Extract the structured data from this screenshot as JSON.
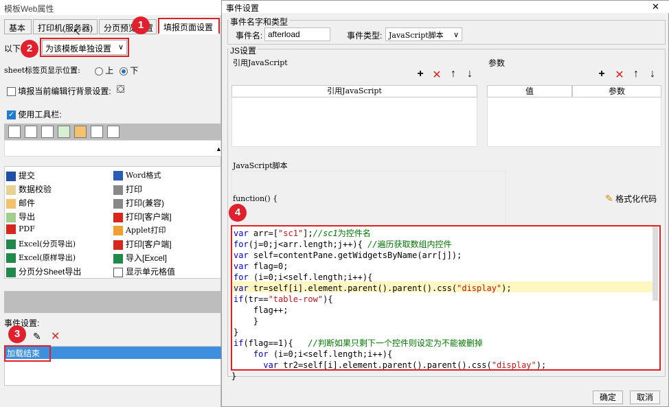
{
  "left_window": {
    "title": "模板Web属性",
    "tabs": [
      {
        "label": "基本"
      },
      {
        "label": "打印机(服务器)"
      },
      {
        "label": "分页预览设置"
      },
      {
        "label": "填报页面设置"
      }
    ],
    "scope_label": "以下",
    "scope_select": "为该模板单独设置",
    "sheet_label": "sheet标签页显示位置:",
    "sheet_options": [
      "上",
      "下"
    ],
    "sheet_selected": "下",
    "bg_label": "填报当前编辑行背景设置:",
    "use_toolbar_label": "使用工具栏:",
    "grid_col1": [
      "提交",
      "数据校验",
      "邮件",
      "导出",
      "PDF",
      "Excel(分页导出)",
      "Excel(原样导出)",
      "分页分Sheet导出"
    ],
    "grid_col2": [
      "Word格式",
      "打印",
      "打印(兼容)",
      "打印[客户端]",
      "Applet打印",
      "打印[客户端]",
      "导入[Excel]",
      "显示单元格值"
    ],
    "event_label": "事件设置:",
    "event_items": [
      "加载结束"
    ]
  },
  "dialog": {
    "title": "事件设置",
    "close": "✕",
    "event_group": "事件名字和类型",
    "event_name_label": "事件名:",
    "event_name_value": "afterload",
    "event_type_label": "事件类型:",
    "event_type_value": "JavaScript脚本",
    "js_group": "JS设置",
    "ref_js_label": "引用JavaScript",
    "ref_js_header": "引用JavaScript",
    "params_label": "参数",
    "params_headers": [
      "值",
      "参数"
    ],
    "js_script_label": "JavaScript脚本",
    "function_text": "function() {",
    "format_code": "格式化代码",
    "closing_brace": "}",
    "ok": "确定",
    "cancel": "取消"
  },
  "badges": [
    "1",
    "2",
    "3",
    "4"
  ],
  "code_lines": [
    [
      {
        "t": "var",
        "c": "kw"
      },
      {
        "t": " arr=["
      },
      {
        "t": "\"sc1\"",
        "c": "str"
      },
      {
        "t": "];"
      },
      {
        "t": "//sc1",
        "c": "cm"
      },
      {
        "t": "为控件名",
        "c": "cmz"
      }
    ],
    [
      {
        "t": "for",
        "c": "kw"
      },
      {
        "t": "(j=0;j<arr.length;j++){ "
      },
      {
        "t": "//",
        "c": "cm"
      },
      {
        "t": "遍历获取数组内控件",
        "c": "cmz"
      }
    ],
    [
      {
        "t": "var",
        "c": "kw"
      },
      {
        "t": " self=contentPane.getWidgetsByName(arr[j]);"
      }
    ],
    [
      {
        "t": "var",
        "c": "kw"
      },
      {
        "t": " flag=0;"
      }
    ],
    [
      {
        "t": "for",
        "c": "kw"
      },
      {
        "t": " (i=0;i<self.length;i++){"
      }
    ],
    [
      {
        "t": "var",
        "c": "kw"
      },
      {
        "t": " tr=self[i].element.parent().parent().css("
      },
      {
        "t": "\"display\"",
        "c": "str"
      },
      {
        "t": ");"
      }
    ],
    [
      {
        "t": "if",
        "c": "kw"
      },
      {
        "t": "(tr=="
      },
      {
        "t": "\"table-row\"",
        "c": "str"
      },
      {
        "t": "){"
      }
    ],
    [
      {
        "t": "    flag++;"
      }
    ],
    [
      {
        "t": "    }"
      }
    ],
    [
      {
        "t": "}"
      }
    ],
    [
      {
        "t": "if",
        "c": "kw"
      },
      {
        "t": "(flag==1){   "
      },
      {
        "t": "//",
        "c": "cm"
      },
      {
        "t": "判断如果只剩下一个控件则设定为不能被删掉",
        "c": "cmz"
      }
    ],
    [
      {
        "t": "    "
      },
      {
        "t": "for",
        "c": "kw"
      },
      {
        "t": " (i=0;i<self.length;i++){"
      }
    ],
    [
      {
        "t": "      "
      },
      {
        "t": "var",
        "c": "kw"
      },
      {
        "t": " tr2=self[i].element.parent().parent().css("
      },
      {
        "t": "\"display\"",
        "c": "str"
      },
      {
        "t": ");"
      }
    ]
  ]
}
